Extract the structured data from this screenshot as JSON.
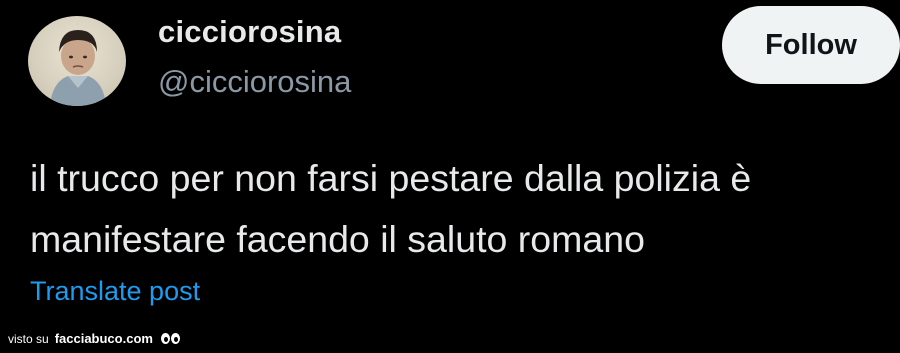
{
  "user": {
    "display_name": "cicciorosina",
    "handle": "@cicciorosina",
    "avatar_icon": "profile-photo-child"
  },
  "actions": {
    "follow_label": "Follow",
    "translate_label": "Translate post"
  },
  "post": {
    "text": "il trucco per non farsi pestare dalla polizia è manifestare facendo il saluto romano"
  },
  "watermark": {
    "prefix": "visto su",
    "site": "facciabuco.com"
  },
  "colors": {
    "background": "#000000",
    "text": "#e7e9ea",
    "secondary_text": "#8b98a5",
    "link": "#1d9bf0",
    "button_bg": "#eff3f4"
  }
}
